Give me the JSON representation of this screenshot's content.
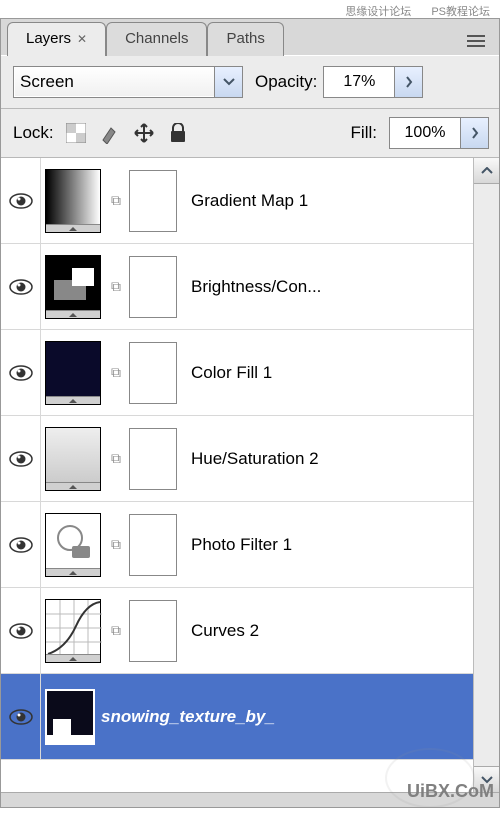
{
  "watermarks": {
    "top_left": "思缘设计论坛",
    "top_right": "PS教程论坛",
    "bottom": "UiBX.CoM"
  },
  "tabs": {
    "layers": "Layers",
    "channels": "Channels",
    "paths": "Paths"
  },
  "blend_mode": "Screen",
  "opacity": {
    "label": "Opacity:",
    "value": "17%"
  },
  "fill": {
    "label": "Fill:",
    "value": "100%"
  },
  "lock": {
    "label": "Lock:"
  },
  "layers": [
    {
      "name": "Gradient Map 1",
      "selected": false,
      "thumb_type": "gradient"
    },
    {
      "name": "Brightness/Con...",
      "selected": false,
      "thumb_type": "brightness"
    },
    {
      "name": "Color Fill 1",
      "selected": false,
      "thumb_type": "colorfill"
    },
    {
      "name": "Hue/Saturation 2",
      "selected": false,
      "thumb_type": "hue"
    },
    {
      "name": "Photo Filter 1",
      "selected": false,
      "thumb_type": "photofilter"
    },
    {
      "name": "Curves 2",
      "selected": false,
      "thumb_type": "curves"
    },
    {
      "name": "snowing_texture_by_",
      "selected": true,
      "thumb_type": "snow"
    }
  ]
}
